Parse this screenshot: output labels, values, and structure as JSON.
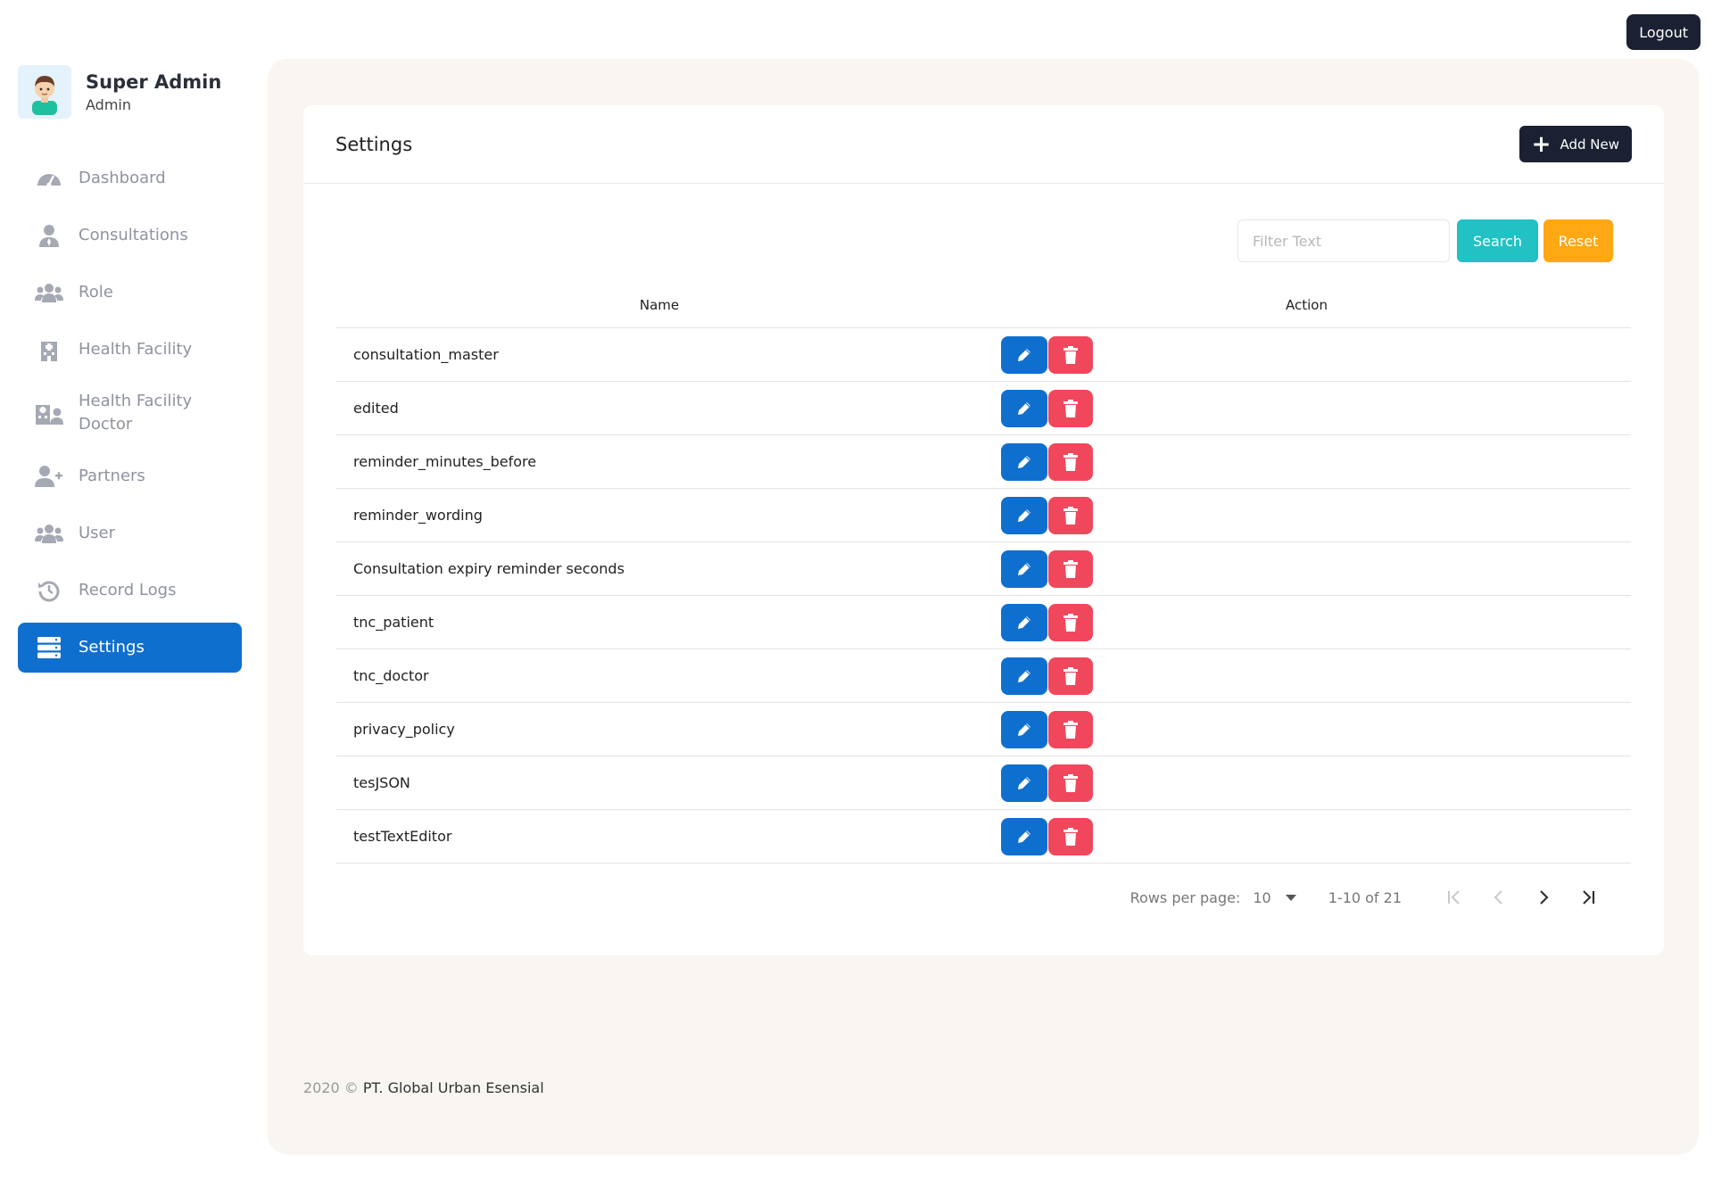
{
  "header": {
    "logout_label": "Logout"
  },
  "profile": {
    "name": "Super Admin",
    "role": "Admin"
  },
  "sidebar": {
    "items": [
      {
        "label": "Dashboard",
        "icon": "dashboard-icon"
      },
      {
        "label": "Consultations",
        "icon": "user-tie-icon"
      },
      {
        "label": "Role",
        "icon": "users-icon"
      },
      {
        "label": "Health Facility",
        "icon": "hospital-icon"
      },
      {
        "label": "Health Facility Doctor",
        "icon": "hospital-user-icon"
      },
      {
        "label": "Partners",
        "icon": "user-plus-icon"
      },
      {
        "label": "User",
        "icon": "users-icon"
      },
      {
        "label": "Record Logs",
        "icon": "history-icon"
      },
      {
        "label": "Settings",
        "icon": "server-icon",
        "active": true
      }
    ]
  },
  "page": {
    "title": "Settings",
    "add_label": "Add New"
  },
  "filter": {
    "placeholder": "Filter Text",
    "search_label": "Search",
    "reset_label": "Reset"
  },
  "table": {
    "columns": [
      "Name",
      "Action"
    ],
    "rows": [
      "consultation_master",
      "edited",
      "reminder_minutes_before",
      "reminder_wording",
      "Consultation expiry reminder seconds",
      "tnc_patient",
      "tnc_doctor",
      "privacy_policy",
      "tesJSON",
      "testTextEditor"
    ]
  },
  "pagination": {
    "rows_per_page_label": "Rows per page:",
    "rows_per_page": "10",
    "range": "1-10 of 21"
  },
  "footer": {
    "year": "2020 ©",
    "company": "PT. Global Urban Esensial"
  },
  "colors": {
    "primary": "#0f6fcf",
    "dark": "#1b2133",
    "teal": "#21c1c4",
    "orange": "#ffa814",
    "red": "#f1475c",
    "main_bg": "#f9f5f1"
  }
}
